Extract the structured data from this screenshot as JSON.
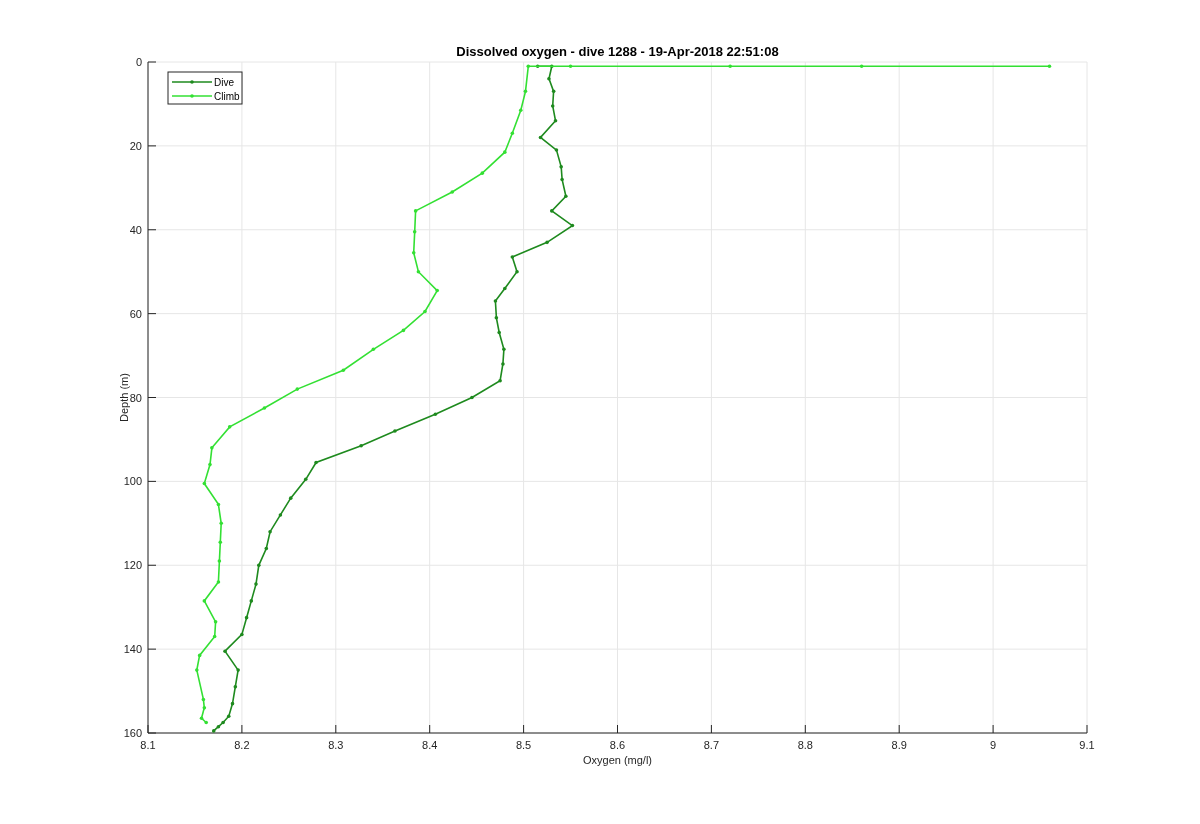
{
  "figure": {
    "chart_data": {
      "type": "line",
      "title": "Dissolved oxygen - dive 1288 - 19-Apr-2018 22:51:08",
      "xlabel": "Oxygen (mg/l)",
      "ylabel": "Depth (m)",
      "xlim": [
        8.1,
        9.1
      ],
      "ylim": [
        160,
        0
      ],
      "grid": true,
      "legend": "upper left",
      "xticks": [
        {
          "value": 8.1,
          "label": "8.1"
        },
        {
          "value": 8.2,
          "label": "8.2"
        },
        {
          "value": 8.3,
          "label": "8.3"
        },
        {
          "value": 8.4,
          "label": "8.4"
        },
        {
          "value": 8.5,
          "label": "8.5"
        },
        {
          "value": 8.6,
          "label": "8.6"
        },
        {
          "value": 8.7,
          "label": "8.7"
        },
        {
          "value": 8.8,
          "label": "8.8"
        },
        {
          "value": 8.9,
          "label": "8.9"
        },
        {
          "value": 9,
          "label": "9"
        },
        {
          "value": 9.1,
          "label": "9.1"
        }
      ],
      "yticks": [
        0,
        20,
        40,
        60,
        80,
        100,
        120,
        140,
        160
      ],
      "series": [
        {
          "name": "Dive",
          "color": "#1e8a1e",
          "x": [
            8.515,
            8.53,
            8.527,
            8.532,
            8.531,
            8.534,
            8.518,
            8.535,
            8.54,
            8.541,
            8.545,
            8.53,
            8.552,
            8.525,
            8.488,
            8.493,
            8.48,
            8.47,
            8.471,
            8.474,
            8.479,
            8.478,
            8.475,
            8.445,
            8.406,
            8.363,
            8.327,
            8.279,
            8.268,
            8.252,
            8.241,
            8.23,
            8.226,
            8.218,
            8.215,
            8.21,
            8.205,
            8.2,
            8.182,
            8.196,
            8.193,
            8.19,
            8.186,
            8.18,
            8.175,
            8.17
          ],
          "values": [
            1,
            1,
            4,
            7,
            10.5,
            14,
            18,
            21,
            25,
            28,
            32,
            35.5,
            39,
            43,
            46.5,
            50,
            54,
            57,
            61,
            64.5,
            68.5,
            72,
            76,
            80,
            84,
            88,
            91.5,
            95.5,
            99.5,
            104,
            108,
            112,
            116,
            120,
            124.5,
            128.5,
            132.5,
            136.5,
            140.5,
            145,
            149,
            153,
            156,
            157.5,
            158.5,
            159.5
          ]
        },
        {
          "name": "Climb",
          "color": "#33e033",
          "x": [
            9.06,
            8.86,
            8.72,
            8.55,
            8.505,
            8.502,
            8.497,
            8.488,
            8.48,
            8.456,
            8.424,
            8.385,
            8.384,
            8.383,
            8.388,
            8.408,
            8.395,
            8.372,
            8.34,
            8.308,
            8.259,
            8.224,
            8.187,
            8.168,
            8.166,
            8.16,
            8.175,
            8.178,
            8.177,
            8.176,
            8.175,
            8.16,
            8.172,
            8.171,
            8.155,
            8.152,
            8.159,
            8.16,
            8.157,
            8.162
          ],
          "values": [
            1,
            1,
            1,
            1,
            1,
            7,
            11.5,
            17,
            21.5,
            26.5,
            31,
            35.5,
            40.5,
            45.5,
            50,
            54.5,
            59.5,
            64,
            68.5,
            73.5,
            78,
            82.5,
            87,
            92,
            96,
            100.5,
            105.5,
            110,
            114.5,
            119,
            124,
            128.5,
            133.5,
            137,
            141.5,
            145,
            152,
            154,
            156.5,
            157.5
          ]
        }
      ]
    }
  }
}
